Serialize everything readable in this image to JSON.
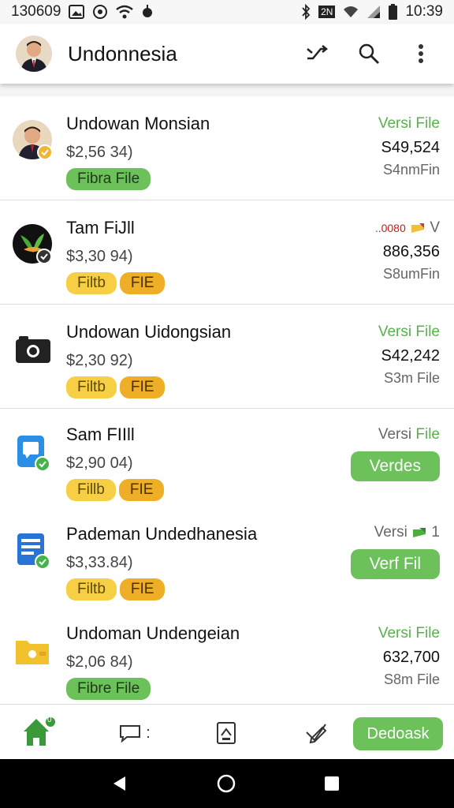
{
  "status_bar": {
    "time_left": "130609",
    "time_right": "10:39",
    "network_label": "2N",
    "icons": [
      "image-icon",
      "location-icon",
      "wifi-icon",
      "bulb-icon",
      "bluetooth-icon",
      "network-icon",
      "wifi-icon",
      "signal-icon",
      "battery-icon"
    ]
  },
  "app_bar": {
    "title": "Undonnesia",
    "actions": [
      "shuffle-icon",
      "search-icon",
      "more-vert-icon"
    ]
  },
  "accounts": [
    {
      "name": "Undowan Monsian",
      "amount": "$2,56 34)",
      "chips": [
        {
          "label": "Fibra File",
          "color": "green"
        }
      ],
      "right_label_prefix": "Versi",
      "right_label_suffix": "File",
      "right_value": "S49,524",
      "right_sub": "S4nmFin",
      "icon": "person-avatar-icon"
    },
    {
      "name": "Tam FiJll",
      "amount": "$3,30 94)",
      "chips": [
        {
          "label": "Filtb",
          "color": "yellow"
        },
        {
          "label": "FIE",
          "color": "orange"
        }
      ],
      "right_label_prefix": "..0080",
      "right_label_suffix": "V",
      "right_value": "886,356",
      "right_sub": "S8umFin",
      "icon": "leaf-logo-icon"
    },
    {
      "name": "Undowan Uidongsian",
      "amount": "$2,30 92)",
      "chips": [
        {
          "label": "Filtb",
          "color": "yellow"
        },
        {
          "label": "FIE",
          "color": "orange"
        }
      ],
      "right_label_prefix": "Versi",
      "right_label_suffix": "File",
      "right_value": "S42,242",
      "right_sub": "S3m File",
      "icon": "camera-icon"
    },
    {
      "name": "Sam FIIll",
      "amount": "$2,90 04)",
      "chips": [
        {
          "label": "Fillb",
          "color": "yellow"
        },
        {
          "label": "FIE",
          "color": "orange"
        }
      ],
      "right_label_prefix": "Versi",
      "right_label_suffix": "File",
      "right_button": "Verdes",
      "icon": "chat-app-icon"
    },
    {
      "name": "Pademan Undedhanesia",
      "amount": "$3,33.84)",
      "chips": [
        {
          "label": "Filtb",
          "color": "yellow"
        },
        {
          "label": "FIE",
          "color": "orange"
        }
      ],
      "right_label_prefix": "Versi",
      "right_label_suffix": "1",
      "right_button": "Verf Fil",
      "icon": "document-app-icon"
    },
    {
      "name": "Undoman Undengeian",
      "amount": "$2,06 84)",
      "chips": [
        {
          "label": "Fibre File",
          "color": "green"
        }
      ],
      "right_label_prefix": "Versi",
      "right_label_suffix": "File",
      "right_value": "632,700",
      "right_sub": "S8m File",
      "icon": "folder-icon"
    }
  ],
  "bottom_nav": {
    "items": [
      "home-icon",
      "chat-icon",
      "document-edit-icon",
      "edit-check-icon"
    ],
    "chat_suffix": ":",
    "home_badge": "0",
    "cta_label": "Dedoask"
  },
  "system_nav": [
    "back-icon",
    "home-circle-icon",
    "recents-icon"
  ],
  "colors": {
    "accent_green": "#6cc15a",
    "chip_yellow": "#f7cf45",
    "chip_orange": "#eeae25",
    "text_green": "#56b24a"
  }
}
